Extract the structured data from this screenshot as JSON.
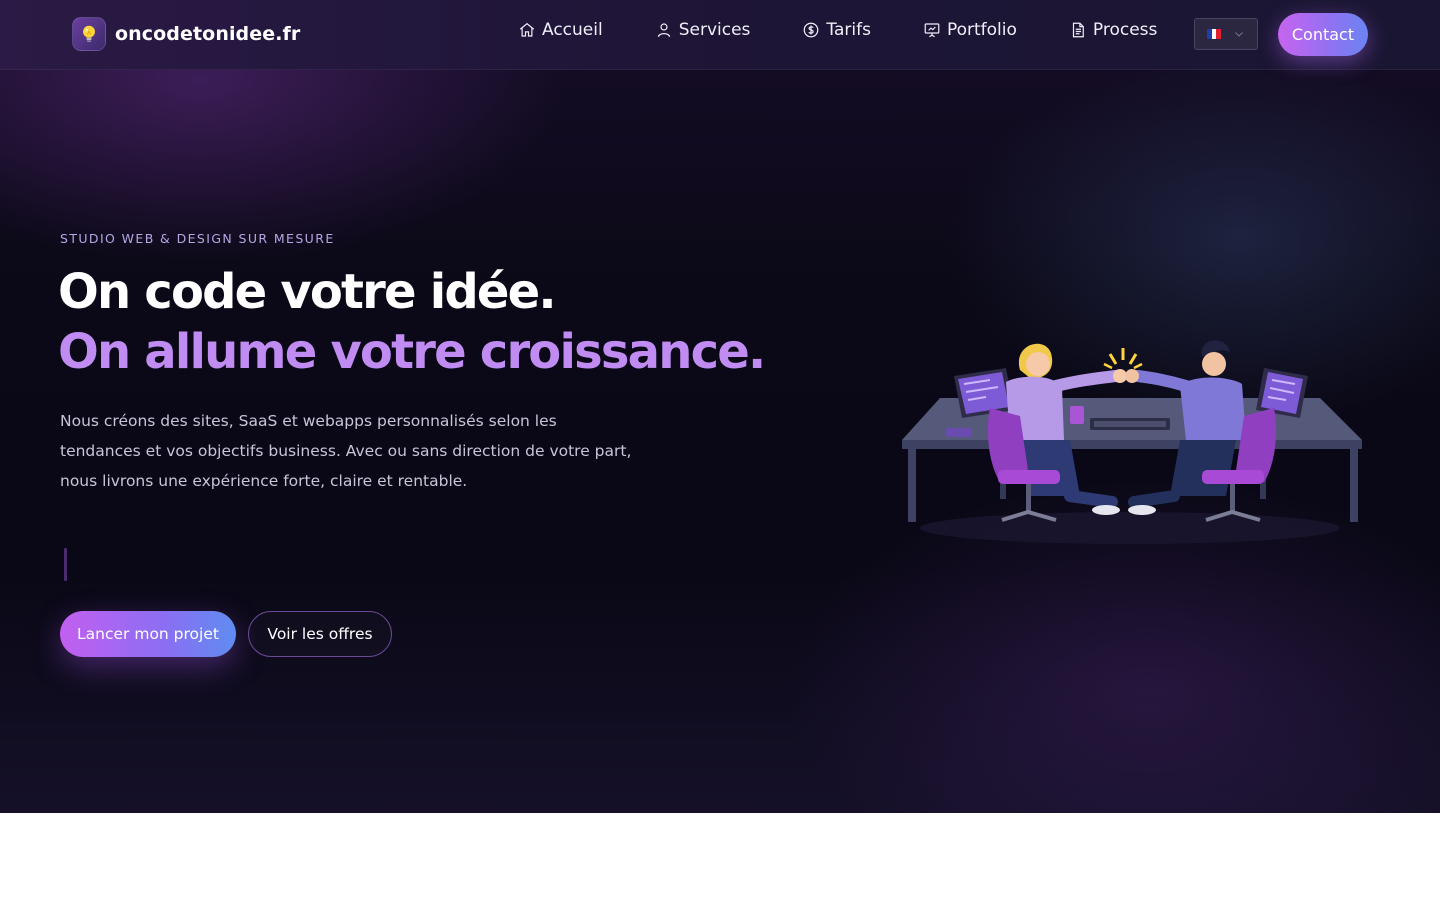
{
  "navbar": {
    "logo_text": "oncodetonidee.fr",
    "logo_icon": "lightbulb-icon",
    "items": [
      {
        "label": "Accueil",
        "icon": "home-icon"
      },
      {
        "label": "Services",
        "icon": "user-icon"
      },
      {
        "label": "Tarifs",
        "icon": "dollar-circle-icon"
      },
      {
        "label": "Portfolio",
        "icon": "presentation-icon"
      },
      {
        "label": "Process",
        "icon": "document-icon"
      }
    ],
    "language": {
      "selected": "fr",
      "icon": "flag-fr-icon"
    },
    "contact_label": "Contact"
  },
  "hero": {
    "eyebrow": "STUDIO WEB & DESIGN SUR MESURE",
    "headline_line1": "On code votre idée.",
    "headline_line2": "On allume votre croissance.",
    "description": "Nous créons des sites, SaaS et webapps personnalisés selon les tendances et vos objectifs business. Avec ou sans direction de votre part, nous livrons une expérience forte, claire et rentable.",
    "primary_cta": "Lancer mon projet",
    "secondary_cta": "Voir les offres"
  },
  "colors": {
    "accent_purple": "#c08cf2",
    "gradient_start": "#c25ff0",
    "gradient_end": "#5f8cf0",
    "background_dark": "#0b0917"
  }
}
